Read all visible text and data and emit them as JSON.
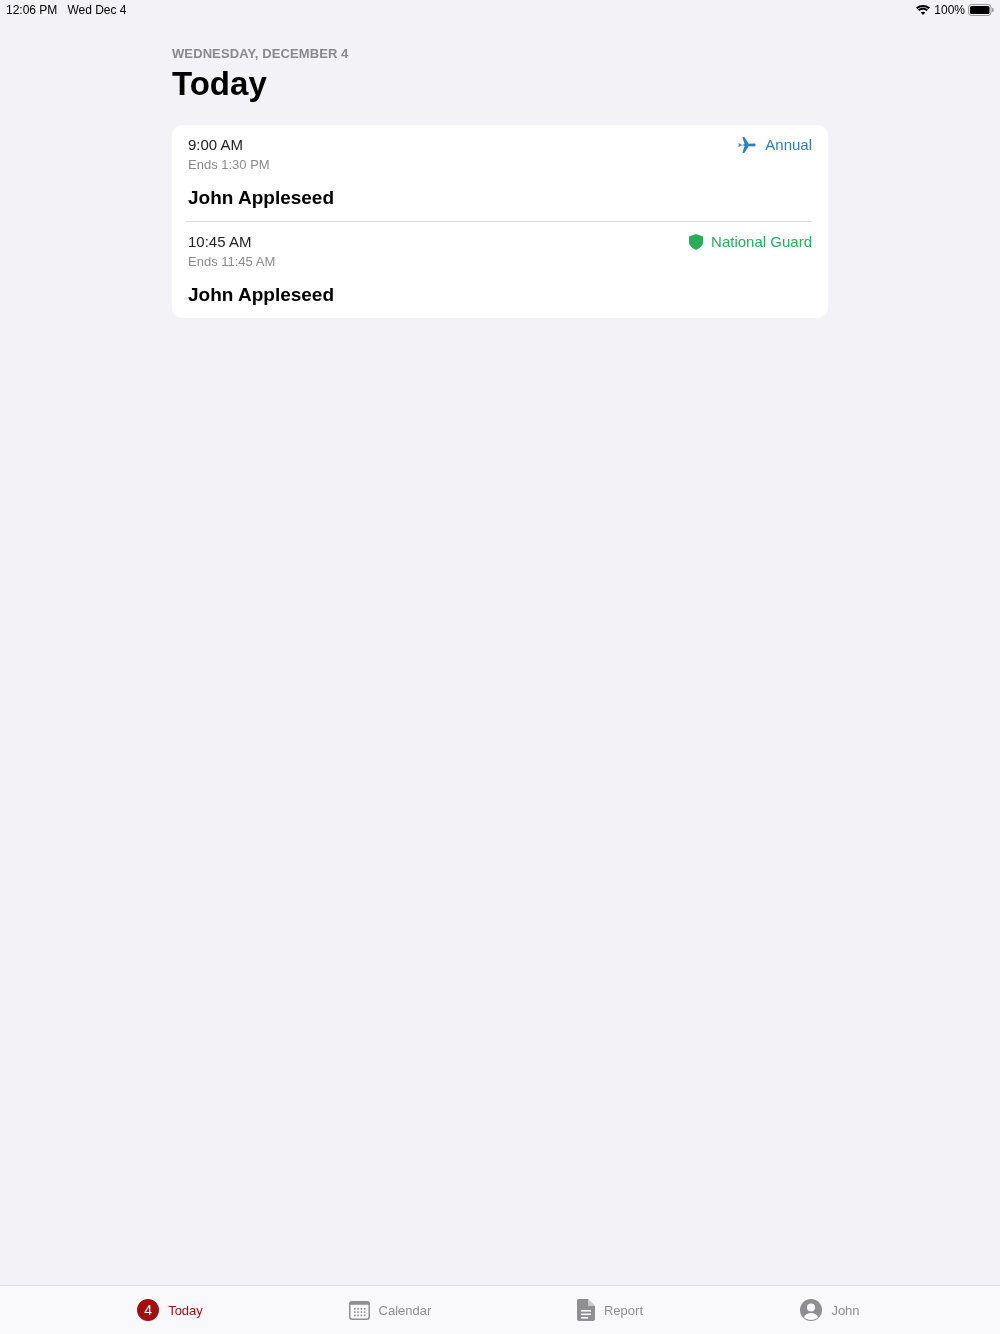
{
  "status_bar": {
    "time": "12:06 PM",
    "date": "Wed Dec 4",
    "battery": "100%"
  },
  "header": {
    "date": "WEDNESDAY, DECEMBER 4",
    "title": "Today"
  },
  "events": [
    {
      "time": "9:00 AM",
      "ends": "Ends 1:30 PM",
      "name": "John Appleseed",
      "category": {
        "kind": "annual",
        "label": "Annual",
        "color": "#2b80c5"
      }
    },
    {
      "time": "10:45 AM",
      "ends": "Ends 11:45 AM",
      "name": "John Appleseed",
      "category": {
        "kind": "guard",
        "label": "National Guard",
        "color": "#27ae5a"
      }
    }
  ],
  "tab_bar": [
    {
      "kind": "badge",
      "badge": "4",
      "label": "Today",
      "selected": true
    },
    {
      "kind": "calendar",
      "label": "Calendar",
      "selected": false
    },
    {
      "kind": "document",
      "label": "Report",
      "selected": false
    },
    {
      "kind": "person",
      "label": "John",
      "selected": false
    }
  ]
}
